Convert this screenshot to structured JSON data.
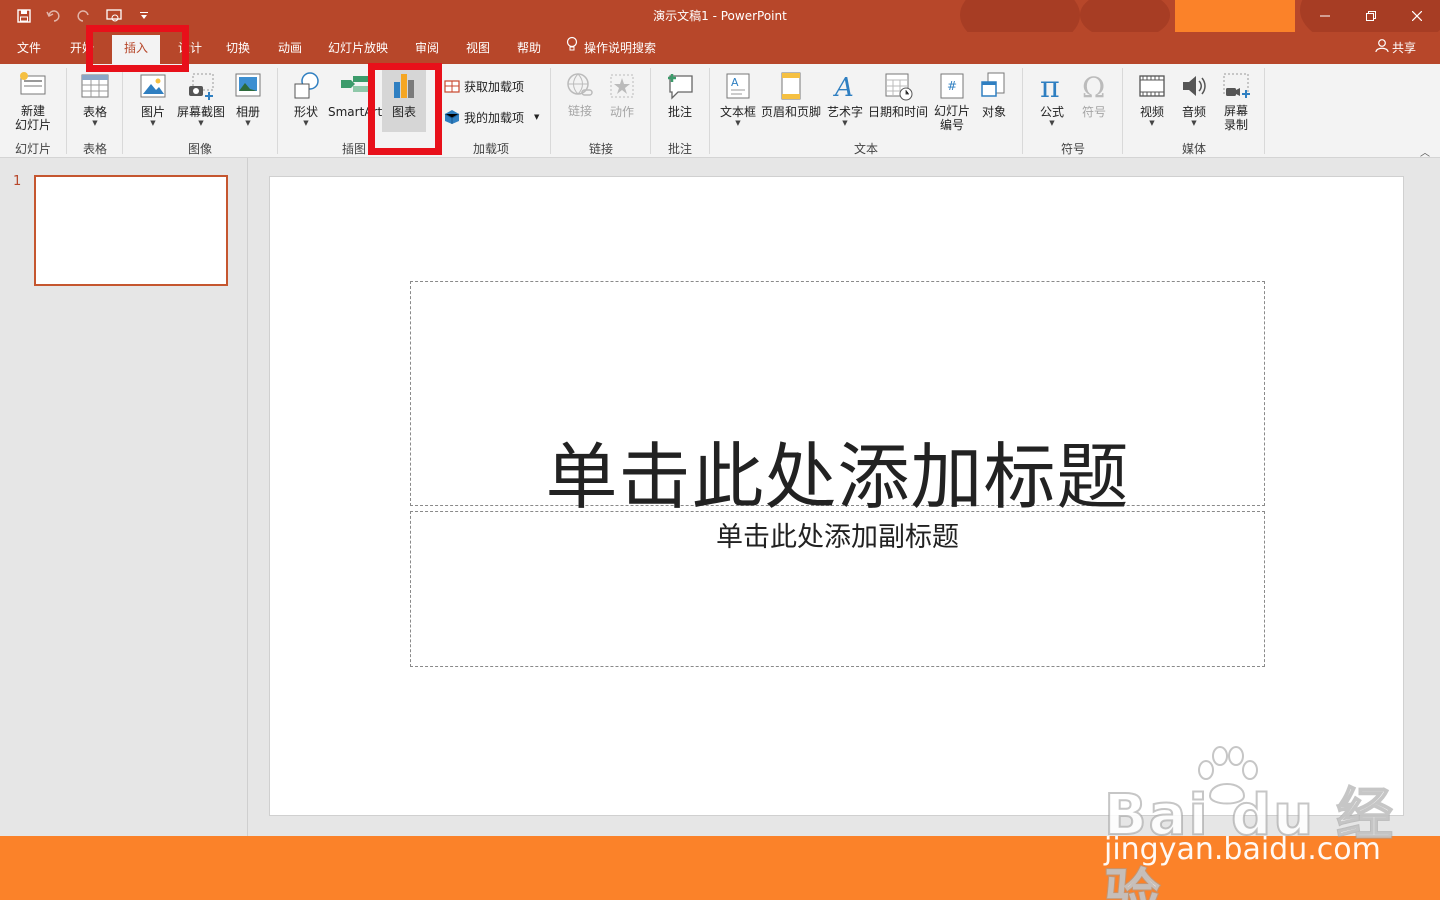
{
  "window": {
    "title": "演示文稿1  -  PowerPoint"
  },
  "tabs": [
    {
      "label": "文件"
    },
    {
      "label": "开始"
    },
    {
      "label": "插入"
    },
    {
      "label": "设计"
    },
    {
      "label": "切换"
    },
    {
      "label": "动画"
    },
    {
      "label": "幻灯片放映"
    },
    {
      "label": "审阅"
    },
    {
      "label": "视图"
    },
    {
      "label": "帮助"
    },
    {
      "label": "操作说明搜索"
    }
  ],
  "share_label": "共享",
  "ribbon": {
    "new_slide": "新建",
    "new_slide_2": "幻灯片",
    "table": "表格",
    "picture": "图片",
    "screenshot": "屏幕截图",
    "album": "相册",
    "shapes": "形状",
    "smartart": "SmartArt",
    "chart": "图表",
    "get_addins": "获取加载项",
    "my_addins": "我的加载项",
    "link": "链接",
    "action": "动作",
    "comment": "批注",
    "textbox": "文本框",
    "header_footer": "页眉和页脚",
    "wordart": "艺术字",
    "datetime": "日期和时间",
    "slide_number": "幻灯片",
    "slide_number_2": "编号",
    "object": "对象",
    "equation": "公式",
    "symbol": "符号",
    "video": "视频",
    "audio": "音频",
    "screen_record": "屏幕",
    "screen_record_2": "录制",
    "groups": {
      "slides": "幻灯片",
      "tables": "表格",
      "images": "图像",
      "illustrations": "插图",
      "addins": "加载项",
      "links": "链接",
      "comments": "批注",
      "text": "文本",
      "symbols": "符号",
      "media": "媒体"
    }
  },
  "thumbnail_number": "1",
  "slide": {
    "title_placeholder": "单击此处添加标题",
    "subtitle_placeholder": "单击此处添加副标题"
  },
  "watermark": {
    "logo": "Bai du 经验",
    "url": "jingyan.baidu.com"
  },
  "colors": {
    "accent": "#b7472a",
    "orange": "#fb8229",
    "annotation_red": "#e8101a"
  }
}
